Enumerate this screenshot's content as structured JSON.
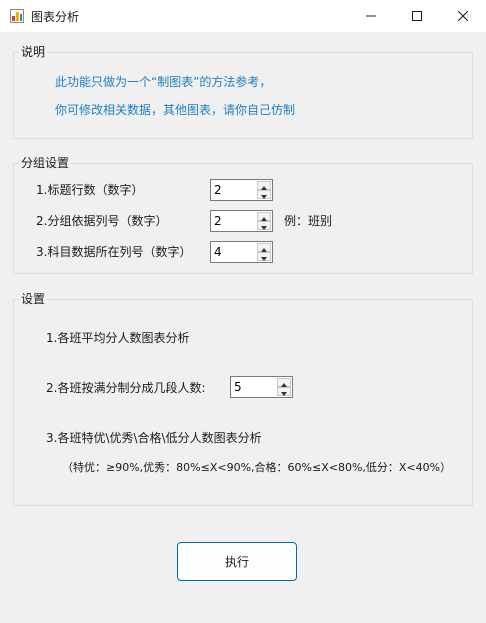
{
  "window": {
    "title": "图表分析",
    "icon": "chart-app-icon",
    "controls": [
      "minimize-icon",
      "maximize-icon",
      "close-icon"
    ]
  },
  "description": {
    "legend": "说明",
    "line1": "此功能只做为一个“制图表”的方法参考，",
    "line2": "你可修改相关数据，其他图表，请你自己仿制",
    "text_color": "#1f7fbf"
  },
  "group_settings": {
    "legend": "分组设置",
    "rows": [
      {
        "label": "1.标题行数（数字）",
        "value": "2"
      },
      {
        "label": "2.分组依据列号（数字）",
        "value": "2"
      },
      {
        "label": "3.科目数据所在列号（数字）",
        "value": "4"
      }
    ],
    "example": "例：班别"
  },
  "settings": {
    "legend": "设置",
    "item1": "1.各班平均分人数图表分析",
    "item2_label": "2.各班按满分制分成几段人数:",
    "item2_value": "5",
    "item3": "3.各班特优\\优秀\\合格\\低分人数图表分析",
    "criteria": "（特优：≥90%,优秀：80%≤X<90%,合格：60%≤X<80%,低分：X<40%）"
  },
  "actions": {
    "execute_label": "执行",
    "accent": "#0067c0"
  }
}
